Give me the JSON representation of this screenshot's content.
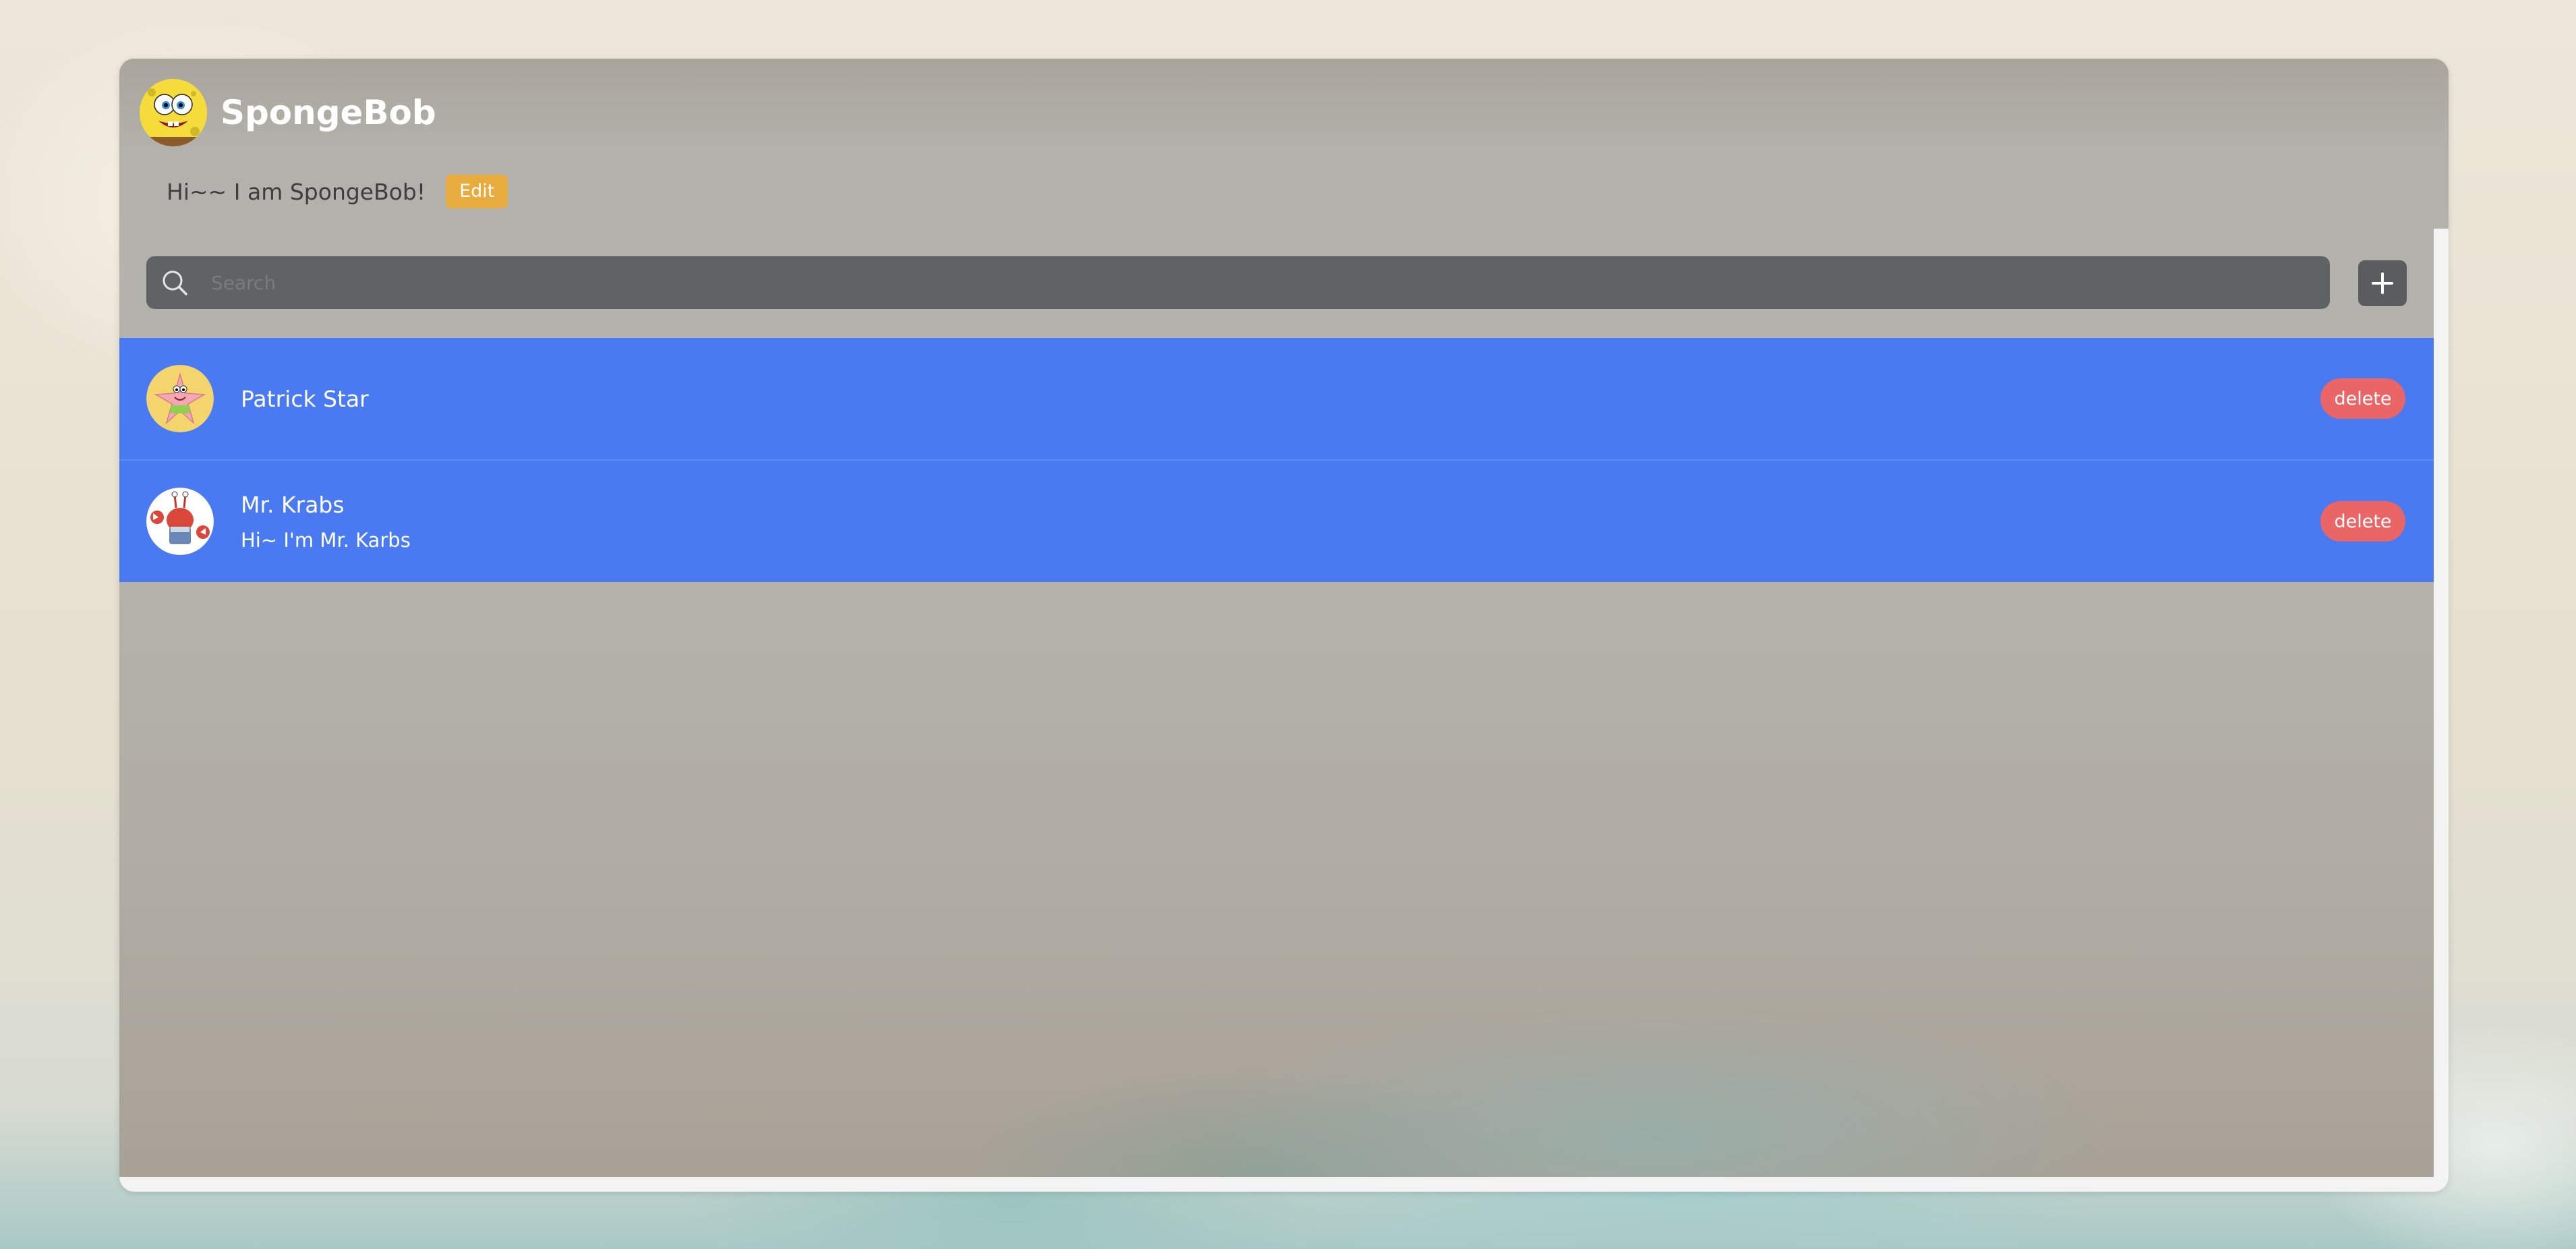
{
  "app": {
    "title": "SpongeBob",
    "bio": "Hi~~ I am SpongeBob!",
    "edit_label": "Edit"
  },
  "search": {
    "placeholder": "Search",
    "value": ""
  },
  "add_button": {
    "icon": "plus-icon"
  },
  "contacts": [
    {
      "name": "Patrick Star",
      "bio": "",
      "avatar": "patrick-avatar",
      "delete_label": "delete"
    },
    {
      "name": "Mr. Krabs",
      "bio": "Hi~ I'm Mr. Karbs",
      "avatar": "mr-krabs-avatar",
      "delete_label": "delete"
    }
  ],
  "colors": {
    "row_background": "#4a7af1",
    "delete_button": "#ea6566",
    "edit_button": "#e8ab3e",
    "search_bar": "#606364"
  }
}
